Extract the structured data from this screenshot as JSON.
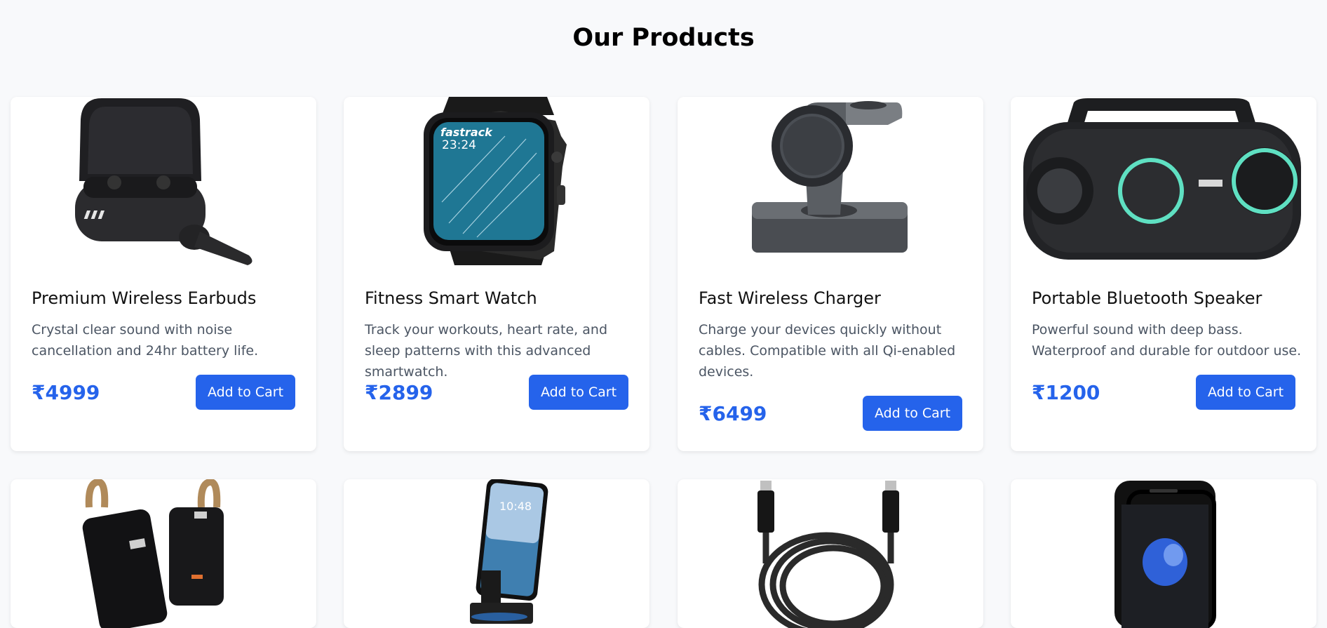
{
  "page": {
    "title": "Our Products"
  },
  "colors": {
    "accent": "#2563eb",
    "background": "#f8f9fb",
    "card": "#ffffff",
    "description_text": "#4b5563"
  },
  "products": [
    {
      "name": "Premium Wireless Earbuds",
      "description": "Crystal clear sound with noise cancellation and 24hr battery life.",
      "price": "₹4999",
      "button": "Add to Cart",
      "image": "earbuds-image"
    },
    {
      "name": "Fitness Smart Watch",
      "description": "Track your workouts, heart rate, and sleep patterns with this advanced smartwatch.",
      "price": "₹2899",
      "button": "Add to Cart",
      "image": "smartwatch-image",
      "watch_brand": "fastrack",
      "watch_time": "23:24"
    },
    {
      "name": "Fast Wireless Charger",
      "description": "Charge your devices quickly without cables. Compatible with all Qi-enabled devices.",
      "price": "₹6499",
      "button": "Add to Cart",
      "image": "wireless-charger-image"
    },
    {
      "name": "Portable Bluetooth Speaker",
      "description": "Powerful sound with deep bass. Waterproof and durable for outdoor use.",
      "price": "₹1200",
      "button": "Add to Cart",
      "image": "bluetooth-speaker-image"
    },
    {
      "image": "power-bank-image"
    },
    {
      "image": "phone-stand-image",
      "phone_time": "10:48"
    },
    {
      "image": "usb-c-cable-image"
    },
    {
      "image": "screen-protector-image"
    }
  ]
}
